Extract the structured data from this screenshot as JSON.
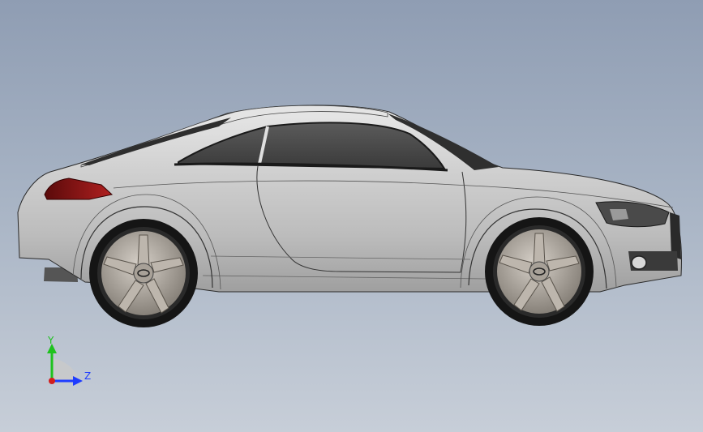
{
  "viewport": {
    "background_top": "#8f9db3",
    "background_bottom": "#c7ced8"
  },
  "model": {
    "body_color": "#c9c9c9",
    "glass_color": "#3f3f3f",
    "taillight_color": "#8a1010",
    "wheel_color": "#9a9a9a"
  },
  "triad": {
    "y_label": "Y",
    "z_label": "Z",
    "y_color": "#1ec21e",
    "z_color": "#1e3cff",
    "origin_color": "#d21e1e"
  }
}
